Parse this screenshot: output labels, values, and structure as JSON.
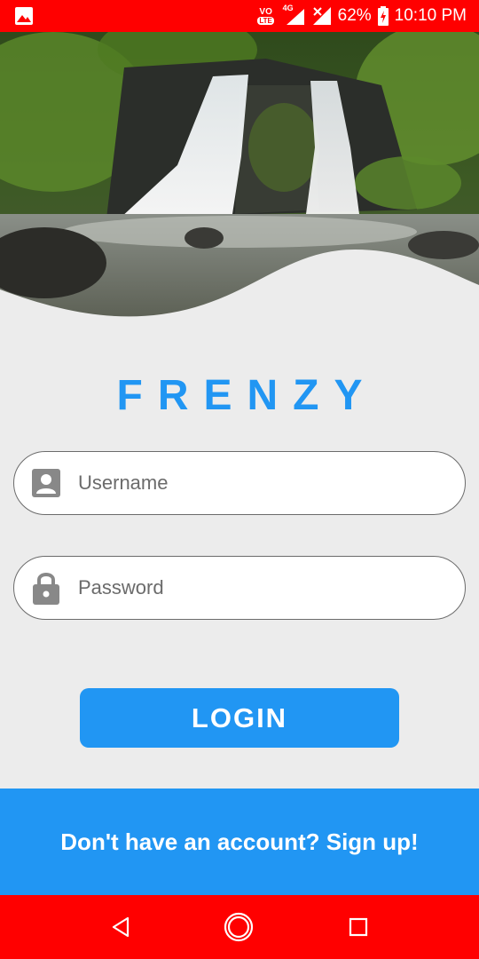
{
  "status_bar": {
    "battery_percent": "62%",
    "time": "10:10 PM",
    "network_type": "4G",
    "volte_top": "VO",
    "volte_bottom": "LTE",
    "icons": [
      "gallery-icon",
      "volte-icon",
      "signal-icon",
      "signal-no-data-icon",
      "battery-charging-icon"
    ]
  },
  "hero": {
    "image": "waterfall-photo"
  },
  "brand": {
    "title": "FRENZY"
  },
  "login_form": {
    "username_placeholder": "Username",
    "username_value": "",
    "password_placeholder": "Password",
    "password_value": "",
    "login_label": "LOGIN"
  },
  "signup": {
    "text": "Don't have an account? Sign up!"
  },
  "nav_bar": {
    "icons": [
      "back-icon",
      "home-icon",
      "recents-icon"
    ]
  },
  "colors": {
    "status_bar": "#ff0000",
    "accent": "#2196f3",
    "background": "#ececec",
    "nav_bar": "#ff0000"
  }
}
